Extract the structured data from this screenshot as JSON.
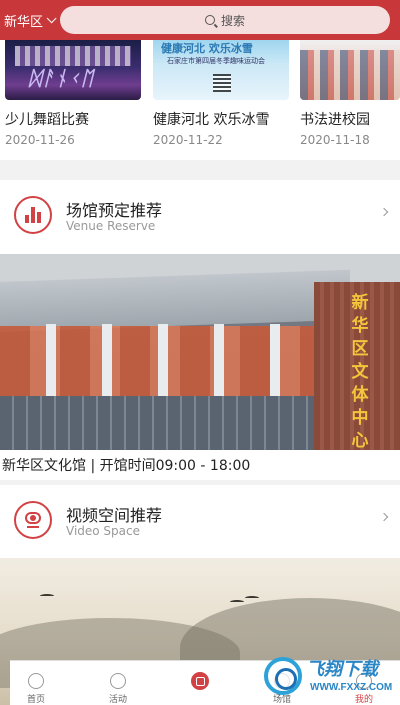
{
  "header": {
    "region": "新华区",
    "search_placeholder": "搜索"
  },
  "activities": [
    {
      "title": "少儿舞蹈比赛",
      "date": "2020-11-26"
    },
    {
      "title": "健康河北 欢乐冰雪",
      "date": "2020-11-22",
      "poster_heading": "健康河北 欢乐冰雪",
      "poster_sub": "石家庄市第四届冬季趣味运动会"
    },
    {
      "title": "书法进校园",
      "date": "2020-11-18"
    }
  ],
  "venue_section": {
    "title": "场馆预定推荐",
    "subtitle": "Venue Reserve",
    "building_sign": "新华区文体中心",
    "caption": "新华区文化馆 | 开馆时间09:00 - 18:00"
  },
  "video_section": {
    "title": "视频空间推荐",
    "subtitle": "Video Space"
  },
  "tabbar": {
    "items": [
      {
        "label": "首页"
      },
      {
        "label": "活动"
      },
      {
        "label": ""
      },
      {
        "label": "场馆"
      },
      {
        "label": "我的"
      }
    ]
  },
  "watermark": {
    "text": "飞翔下载",
    "url": "WWW.FXXZ.COM"
  },
  "colors": {
    "brand_red": "#c8383a",
    "accent_red": "#d24144"
  }
}
